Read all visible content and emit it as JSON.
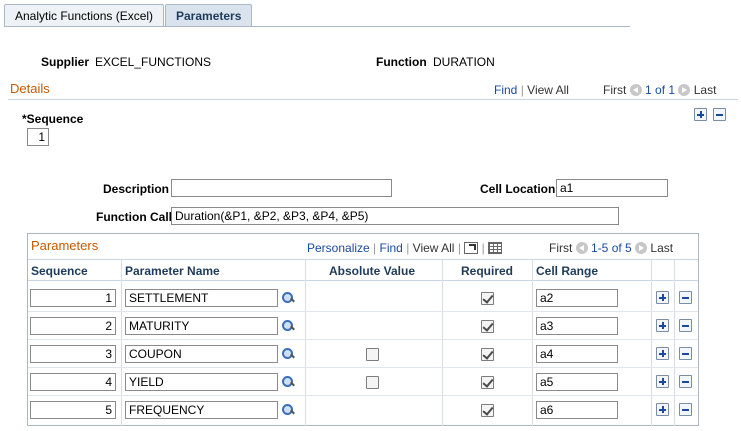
{
  "tabs": [
    {
      "label": "Analytic Functions (Excel)",
      "active": false
    },
    {
      "label": "Parameters",
      "active": true
    }
  ],
  "header": {
    "supplier_label": "Supplier",
    "supplier_value": "EXCEL_FUNCTIONS",
    "function_label": "Function",
    "function_value": "DURATION"
  },
  "details": {
    "title": "Details",
    "find": "Find",
    "view_all": "View All",
    "first": "First",
    "range": "1 of 1",
    "last": "Last",
    "sequence_label": "*Sequence",
    "sequence_value": "1",
    "description_label": "Description",
    "description_value": "",
    "cell_location_label": "Cell Location",
    "cell_location_value": "a1",
    "function_call_label": "Function Call",
    "function_call_value": "Duration(&P1, &P2, &P3, &P4, &P5)"
  },
  "parameters": {
    "title": "Parameters",
    "personalize": "Personalize",
    "find": "Find",
    "view_all": "View All",
    "first": "First",
    "range": "1-5 of 5",
    "last": "Last",
    "columns": {
      "sequence": "Sequence",
      "name": "Parameter Name",
      "absolute": "Absolute Value",
      "required": "Required",
      "cell_range": "Cell Range"
    },
    "rows": [
      {
        "sequence": "1",
        "name": "SETTLEMENT",
        "absolute": null,
        "required": true,
        "cell_range": "a2"
      },
      {
        "sequence": "2",
        "name": "MATURITY",
        "absolute": null,
        "required": true,
        "cell_range": "a3"
      },
      {
        "sequence": "3",
        "name": "COUPON",
        "absolute": false,
        "required": true,
        "cell_range": "a4"
      },
      {
        "sequence": "4",
        "name": "YIELD",
        "absolute": false,
        "required": true,
        "cell_range": "a5"
      },
      {
        "sequence": "5",
        "name": "FREQUENCY",
        "absolute": null,
        "required": true,
        "cell_range": "a6"
      }
    ]
  },
  "colors": {
    "section_title": "#c65a00",
    "link": "#1a4aa0",
    "header_text": "#1f3b5a"
  }
}
